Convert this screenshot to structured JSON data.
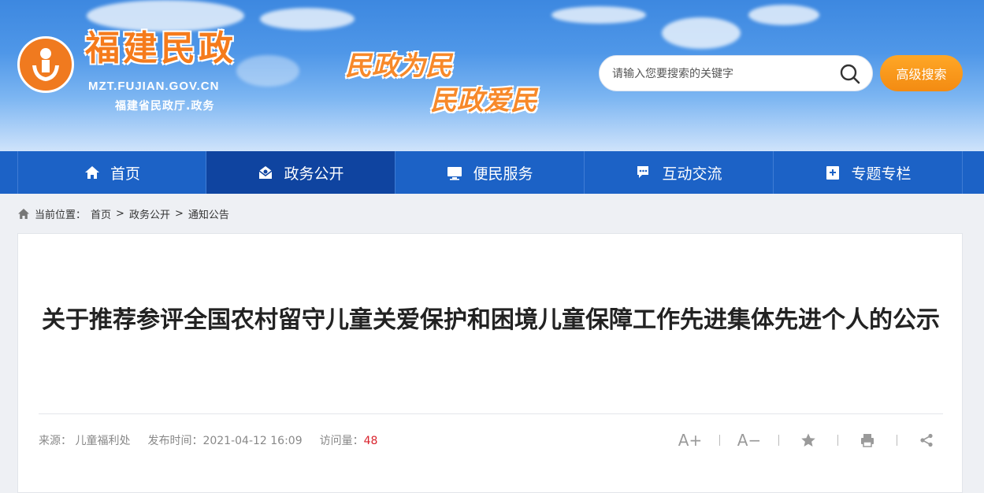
{
  "site": {
    "title": "福建民政",
    "url": "MZT.FUJIAN.GOV.CN",
    "subtitle": "福建省民政厅.政务",
    "slogan1": "民政为民",
    "slogan2": "民政爱民"
  },
  "search": {
    "placeholder": "请输入您要搜索的关键字",
    "advanced_label": "高级搜索"
  },
  "nav": [
    {
      "label": "首页",
      "icon": "home-icon"
    },
    {
      "label": "政务公开",
      "icon": "envelope-icon",
      "active": true
    },
    {
      "label": "便民服务",
      "icon": "monitor-icon"
    },
    {
      "label": "互动交流",
      "icon": "chat-icon"
    },
    {
      "label": "专题专栏",
      "icon": "bookmark-icon"
    }
  ],
  "breadcrumb": {
    "prefix": "当前位置：",
    "items": [
      "首页",
      "政务公开",
      "通知公告"
    ],
    "separator": ">"
  },
  "article": {
    "title": "关于推荐参评全国农村留守儿童关爱保护和困境儿童保障工作先进集体先进个人的公示",
    "source_label": "来源：",
    "source": "儿童福利处",
    "date_label": "发布时间：",
    "date": "2021-04-12 16:09",
    "views_label": "访问量：",
    "views": "48"
  },
  "tools": {
    "font_up": "A+",
    "font_down": "A−"
  },
  "colors": {
    "nav_bg": "#1c62c6",
    "nav_active": "#0f44a0",
    "accent_orange": "#f38b12",
    "views_red": "#d9232d"
  }
}
